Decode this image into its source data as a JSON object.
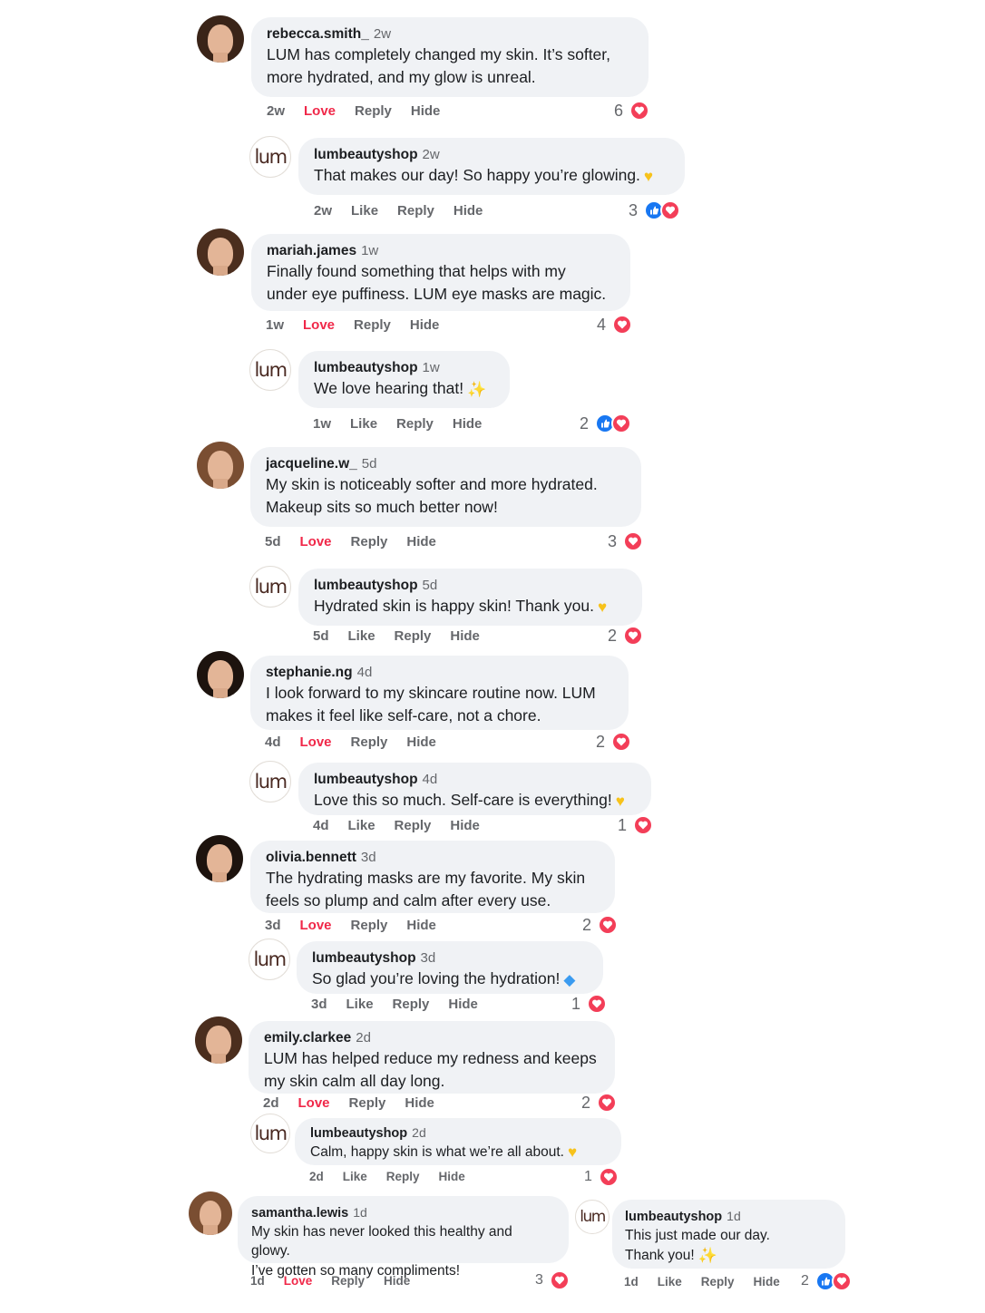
{
  "comments": [
    {
      "user": "rebecca.smith_",
      "time": "2w",
      "lines": [
        "LUM has completely changed my skin. It’s softer,",
        "more hydrated, and my glow is unreal."
      ],
      "actions": {
        "time": "2w",
        "react": "Love",
        "reply": "Reply",
        "hide": "Hide"
      },
      "count": "6",
      "reactions": [
        "heart-icon"
      ],
      "reply": {
        "avatar_text": "lum",
        "user": "lumbeautyshop",
        "time": "2w",
        "lines": [
          "That makes our day! So happy you’re glowing."
        ],
        "emoji": "yellow-heart",
        "actions": {
          "time": "2w",
          "react": "Like",
          "reply": "Reply",
          "hide": "Hide"
        },
        "count": "3",
        "reactions": [
          "like-icon",
          "heart-icon"
        ]
      }
    },
    {
      "user": "mariah.james",
      "time": "1w",
      "lines": [
        "Finally found something that helps with my",
        "under eye puffiness. LUM eye masks are magic."
      ],
      "actions": {
        "time": "1w",
        "react": "Love",
        "reply": "Reply",
        "hide": "Hide"
      },
      "count": "4",
      "reactions": [
        "heart-icon"
      ],
      "reply": {
        "avatar_text": "lum",
        "user": "lumbeautyshop",
        "time": "1w",
        "lines": [
          "We love hearing that!"
        ],
        "emoji": "sparkles",
        "actions": {
          "time": "1w",
          "react": "Like",
          "reply": "Reply",
          "hide": "Hide"
        },
        "count": "2",
        "reactions": [
          "like-icon",
          "heart-icon"
        ]
      }
    },
    {
      "user": "jacqueline.w_",
      "time": "5d",
      "lines": [
        "My skin is noticeably softer and more hydrated.",
        "Makeup sits so much better now!"
      ],
      "actions": {
        "time": "5d",
        "react": "Love",
        "reply": "Reply",
        "hide": "Hide"
      },
      "count": "3",
      "reactions": [
        "heart-icon"
      ],
      "reply": {
        "avatar_text": "lum",
        "user": "lumbeautyshop",
        "time": "5d",
        "lines": [
          "Hydrated skin is happy skin! Thank you."
        ],
        "emoji": "yellow-heart",
        "actions": {
          "time": "5d",
          "react": "Like",
          "reply": "Reply",
          "hide": "Hide"
        },
        "count": "2",
        "reactions": [
          "heart-icon"
        ]
      }
    },
    {
      "user": "stephanie.ng",
      "time": "4d",
      "lines": [
        "I look forward to my skincare routine now. LUM",
        "makes it feel like self-care, not a chore."
      ],
      "actions": {
        "time": "4d",
        "react": "Love",
        "reply": "Reply",
        "hide": "Hide"
      },
      "count": "2",
      "reactions": [
        "heart-icon"
      ],
      "reply": {
        "avatar_text": "lum",
        "user": "lumbeautyshop",
        "time": "4d",
        "lines": [
          "Love this so much. Self-care is everything!"
        ],
        "emoji": "yellow-heart",
        "actions": {
          "time": "4d",
          "react": "Like",
          "reply": "Reply",
          "hide": "Hide"
        },
        "count": "1",
        "reactions": [
          "heart-icon"
        ]
      }
    },
    {
      "user": "olivia.bennett",
      "time": "3d",
      "lines": [
        "The hydrating masks are my favorite. My skin",
        "feels so plump and calm after every use."
      ],
      "actions": {
        "time": "3d",
        "react": "Love",
        "reply": "Reply",
        "hide": "Hide"
      },
      "count": "2",
      "reactions": [
        "heart-icon"
      ],
      "reply": {
        "avatar_text": "lum",
        "user": "lumbeautyshop",
        "time": "3d",
        "lines": [
          "So glad you’re loving the hydration!"
        ],
        "emoji": "droplet",
        "actions": {
          "time": "3d",
          "react": "Like",
          "reply": "Reply",
          "hide": "Hide"
        },
        "count": "1",
        "reactions": [
          "heart-icon"
        ]
      }
    },
    {
      "user": "emily.clarkee",
      "time": "2d",
      "lines": [
        "LUM has helped reduce my redness and keeps",
        "my skin calm all day long."
      ],
      "actions": {
        "time": "2d",
        "react": "Love",
        "reply": "Reply",
        "hide": "Hide"
      },
      "count": "2",
      "reactions": [
        "heart-icon"
      ],
      "reply": {
        "avatar_text": "lum",
        "user": "lumbeautyshop",
        "time": "2d",
        "lines": [
          "Calm, happy skin is what we’re all about."
        ],
        "emoji": "yellow-heart",
        "actions": {
          "time": "2d",
          "react": "Like",
          "reply": "Reply",
          "hide": "Hide"
        },
        "count": "1",
        "reactions": [
          "heart-icon"
        ]
      }
    },
    {
      "user": "samantha.lewis",
      "time": "1d",
      "lines": [
        "My skin has never looked this healthy and glowy.",
        "I’ve gotten so many compliments!"
      ],
      "actions": {
        "time": "1d",
        "react": "Love",
        "reply": "Reply",
        "hide": "Hide"
      },
      "count": "3",
      "reactions": [
        "heart-icon"
      ],
      "reply": {
        "avatar_text": "lum",
        "user": "lumbeautyshop",
        "time": "1d",
        "lines": [
          "This just made our day.",
          "Thank you!"
        ],
        "emoji": "sparkles",
        "actions": {
          "time": "1d",
          "react": "Like",
          "reply": "Reply",
          "hide": "Hide"
        },
        "count": "2",
        "reactions": [
          "like-icon",
          "heart-icon"
        ]
      }
    }
  ],
  "colors": {
    "bubble": "#f0f2f5",
    "love": "#f02849",
    "heart": "#f33e58",
    "like": "#1877f2",
    "muted": "#65676b"
  }
}
